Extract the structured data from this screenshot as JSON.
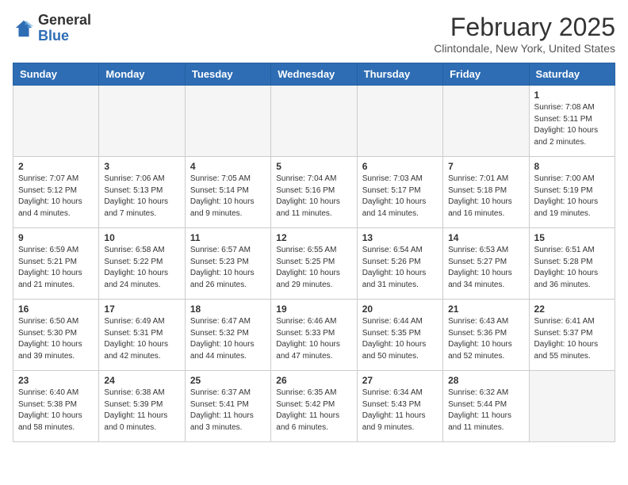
{
  "header": {
    "logo_general": "General",
    "logo_blue": "Blue",
    "month_title": "February 2025",
    "subtitle": "Clintondale, New York, United States"
  },
  "weekdays": [
    "Sunday",
    "Monday",
    "Tuesday",
    "Wednesday",
    "Thursday",
    "Friday",
    "Saturday"
  ],
  "weeks": [
    [
      {
        "day": "",
        "info": ""
      },
      {
        "day": "",
        "info": ""
      },
      {
        "day": "",
        "info": ""
      },
      {
        "day": "",
        "info": ""
      },
      {
        "day": "",
        "info": ""
      },
      {
        "day": "",
        "info": ""
      },
      {
        "day": "1",
        "info": "Sunrise: 7:08 AM\nSunset: 5:11 PM\nDaylight: 10 hours\nand 2 minutes."
      }
    ],
    [
      {
        "day": "2",
        "info": "Sunrise: 7:07 AM\nSunset: 5:12 PM\nDaylight: 10 hours\nand 4 minutes."
      },
      {
        "day": "3",
        "info": "Sunrise: 7:06 AM\nSunset: 5:13 PM\nDaylight: 10 hours\nand 7 minutes."
      },
      {
        "day": "4",
        "info": "Sunrise: 7:05 AM\nSunset: 5:14 PM\nDaylight: 10 hours\nand 9 minutes."
      },
      {
        "day": "5",
        "info": "Sunrise: 7:04 AM\nSunset: 5:16 PM\nDaylight: 10 hours\nand 11 minutes."
      },
      {
        "day": "6",
        "info": "Sunrise: 7:03 AM\nSunset: 5:17 PM\nDaylight: 10 hours\nand 14 minutes."
      },
      {
        "day": "7",
        "info": "Sunrise: 7:01 AM\nSunset: 5:18 PM\nDaylight: 10 hours\nand 16 minutes."
      },
      {
        "day": "8",
        "info": "Sunrise: 7:00 AM\nSunset: 5:19 PM\nDaylight: 10 hours\nand 19 minutes."
      }
    ],
    [
      {
        "day": "9",
        "info": "Sunrise: 6:59 AM\nSunset: 5:21 PM\nDaylight: 10 hours\nand 21 minutes."
      },
      {
        "day": "10",
        "info": "Sunrise: 6:58 AM\nSunset: 5:22 PM\nDaylight: 10 hours\nand 24 minutes."
      },
      {
        "day": "11",
        "info": "Sunrise: 6:57 AM\nSunset: 5:23 PM\nDaylight: 10 hours\nand 26 minutes."
      },
      {
        "day": "12",
        "info": "Sunrise: 6:55 AM\nSunset: 5:25 PM\nDaylight: 10 hours\nand 29 minutes."
      },
      {
        "day": "13",
        "info": "Sunrise: 6:54 AM\nSunset: 5:26 PM\nDaylight: 10 hours\nand 31 minutes."
      },
      {
        "day": "14",
        "info": "Sunrise: 6:53 AM\nSunset: 5:27 PM\nDaylight: 10 hours\nand 34 minutes."
      },
      {
        "day": "15",
        "info": "Sunrise: 6:51 AM\nSunset: 5:28 PM\nDaylight: 10 hours\nand 36 minutes."
      }
    ],
    [
      {
        "day": "16",
        "info": "Sunrise: 6:50 AM\nSunset: 5:30 PM\nDaylight: 10 hours\nand 39 minutes."
      },
      {
        "day": "17",
        "info": "Sunrise: 6:49 AM\nSunset: 5:31 PM\nDaylight: 10 hours\nand 42 minutes."
      },
      {
        "day": "18",
        "info": "Sunrise: 6:47 AM\nSunset: 5:32 PM\nDaylight: 10 hours\nand 44 minutes."
      },
      {
        "day": "19",
        "info": "Sunrise: 6:46 AM\nSunset: 5:33 PM\nDaylight: 10 hours\nand 47 minutes."
      },
      {
        "day": "20",
        "info": "Sunrise: 6:44 AM\nSunset: 5:35 PM\nDaylight: 10 hours\nand 50 minutes."
      },
      {
        "day": "21",
        "info": "Sunrise: 6:43 AM\nSunset: 5:36 PM\nDaylight: 10 hours\nand 52 minutes."
      },
      {
        "day": "22",
        "info": "Sunrise: 6:41 AM\nSunset: 5:37 PM\nDaylight: 10 hours\nand 55 minutes."
      }
    ],
    [
      {
        "day": "23",
        "info": "Sunrise: 6:40 AM\nSunset: 5:38 PM\nDaylight: 10 hours\nand 58 minutes."
      },
      {
        "day": "24",
        "info": "Sunrise: 6:38 AM\nSunset: 5:39 PM\nDaylight: 11 hours\nand 0 minutes."
      },
      {
        "day": "25",
        "info": "Sunrise: 6:37 AM\nSunset: 5:41 PM\nDaylight: 11 hours\nand 3 minutes."
      },
      {
        "day": "26",
        "info": "Sunrise: 6:35 AM\nSunset: 5:42 PM\nDaylight: 11 hours\nand 6 minutes."
      },
      {
        "day": "27",
        "info": "Sunrise: 6:34 AM\nSunset: 5:43 PM\nDaylight: 11 hours\nand 9 minutes."
      },
      {
        "day": "28",
        "info": "Sunrise: 6:32 AM\nSunset: 5:44 PM\nDaylight: 11 hours\nand 11 minutes."
      },
      {
        "day": "",
        "info": ""
      }
    ]
  ]
}
